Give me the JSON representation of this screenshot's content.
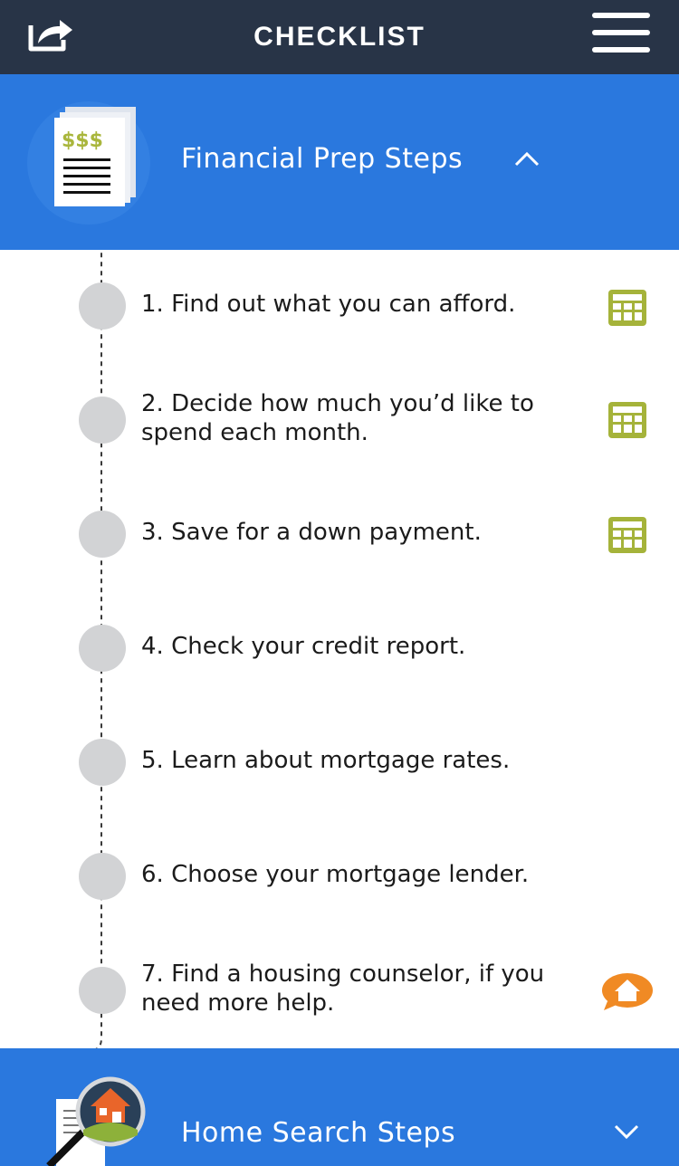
{
  "header": {
    "title": "CHECKLIST",
    "share_icon": "share-icon",
    "menu_icon": "hamburger-menu-icon"
  },
  "sections": [
    {
      "title": "Financial Prep Steps",
      "state": "expanded",
      "illustration": "dollar-document-icon",
      "illustration_text": "$$$",
      "toggle_icon": "chevron-up-icon"
    },
    {
      "title": "Home Search Steps",
      "state": "collapsed",
      "illustration": "magnifier-house-icon",
      "toggle_icon": "chevron-down-icon"
    }
  ],
  "steps": [
    {
      "text": "1. Find out what you can afford.",
      "action_icon": "calculator-icon"
    },
    {
      "text": "2. Decide how much you’d like to spend each month.",
      "action_icon": "calculator-icon"
    },
    {
      "text": "3. Save for a down payment.",
      "action_icon": "calculator-icon"
    },
    {
      "text": "4. Check your credit report.",
      "action_icon": ""
    },
    {
      "text": "5. Learn about mortgage rates.",
      "action_icon": ""
    },
    {
      "text": "6. Choose your mortgage lender.",
      "action_icon": ""
    },
    {
      "text": "7. Find a housing counselor, if you need more help.",
      "action_icon": "housing-counselor-icon"
    }
  ],
  "colors": {
    "header_bg": "#283447",
    "section_bg": "#2a78de",
    "bullet": "#d2d3d5",
    "calculator_green": "#a5b33a",
    "counselor_orange": "#f08a24"
  }
}
